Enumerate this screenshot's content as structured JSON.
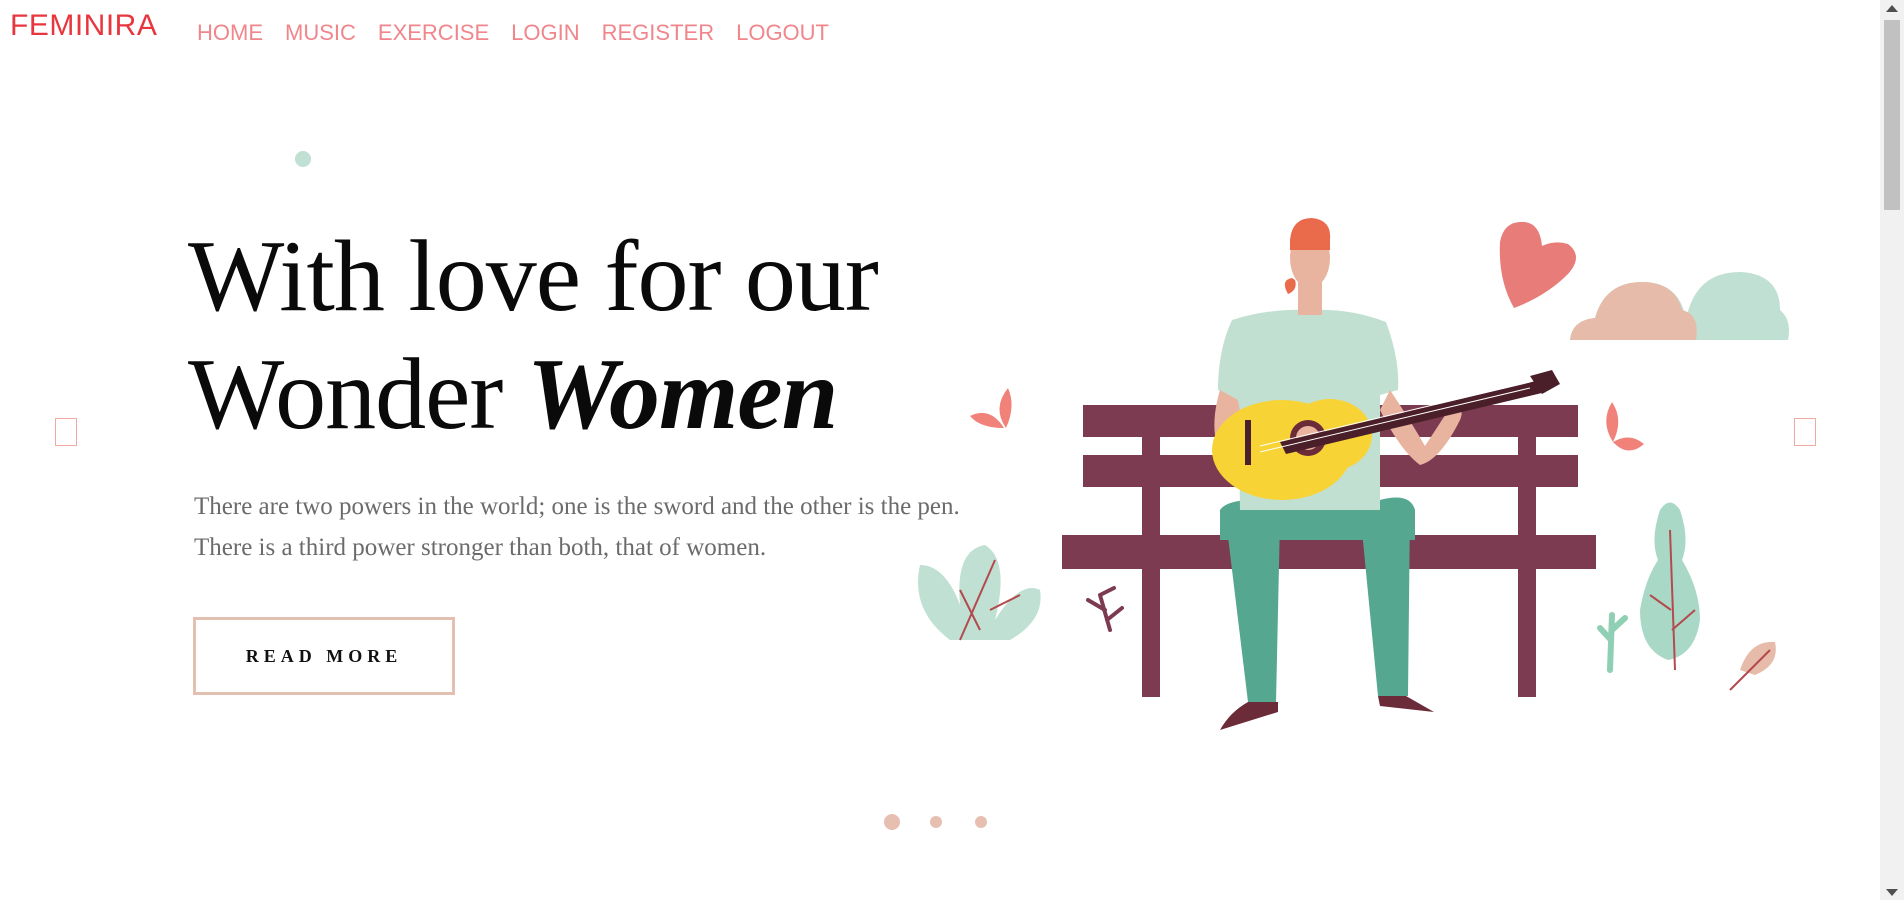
{
  "brand": "FEMINIRA",
  "nav": {
    "items": [
      "HOME",
      "MUSIC",
      "EXERCISE",
      "LOGIN",
      "REGISTER",
      "LOGOUT"
    ]
  },
  "hero": {
    "title_line1": "With love for our",
    "title_line2_prefix": "Wonder ",
    "title_line2_emphasis": "Women",
    "description_line1": "There are two powers in the world; one is the sword and the other is the pen.",
    "description_line2": "There is a third power stronger than both, that of women.",
    "button_label": "READ MORE"
  },
  "slider": {
    "slide_count": 3,
    "active_index": 0
  },
  "colors": {
    "brand": "#e8363f",
    "nav_link": "#f0868b",
    "button_border": "#e2bfb1",
    "bench": "#7d3b52",
    "guitar": "#f8d335",
    "shirt": "#c2e0d2",
    "pants": "#56a78f",
    "heart": "#e77c78"
  },
  "icons": {
    "prev": "chevron-left-icon",
    "next": "chevron-right-icon"
  }
}
